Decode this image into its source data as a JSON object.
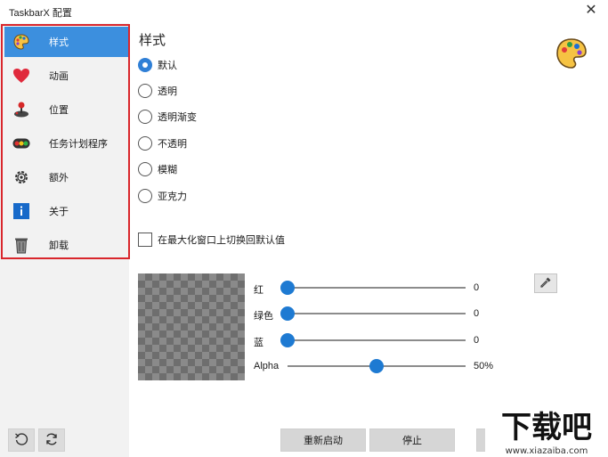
{
  "window": {
    "title": "TaskbarX 配置",
    "close_glyph": "✕"
  },
  "sidebar": {
    "items": [
      {
        "label": "样式",
        "icon": "palette-icon",
        "active": true
      },
      {
        "label": "动画",
        "icon": "heart-icon"
      },
      {
        "label": "位置",
        "icon": "joystick-icon"
      },
      {
        "label": "任务计划程序",
        "icon": "traffic-light-icon"
      },
      {
        "label": "额外",
        "icon": "gear-icon"
      },
      {
        "label": "关于",
        "icon": "info-icon"
      },
      {
        "label": "卸载",
        "icon": "trash-icon"
      }
    ],
    "bottom_buttons": [
      {
        "icon": "undo-icon"
      },
      {
        "icon": "refresh-icon"
      }
    ]
  },
  "main": {
    "heading": "样式",
    "styles": [
      {
        "label": "默认",
        "checked": true
      },
      {
        "label": "透明",
        "checked": false
      },
      {
        "label": "透明渐变",
        "checked": false
      },
      {
        "label": "不透明",
        "checked": false
      },
      {
        "label": "模糊",
        "checked": false
      },
      {
        "label": "亚克力",
        "checked": false
      }
    ],
    "revert_checkbox": {
      "label": "在最大化窗口上切换回默认值",
      "checked": false
    },
    "color": {
      "sliders": [
        {
          "label": "红",
          "value_text": "0",
          "fraction": 0
        },
        {
          "label": "绿色",
          "value_text": "0",
          "fraction": 0
        },
        {
          "label": "蓝",
          "value_text": "0",
          "fraction": 0
        },
        {
          "label": "Alpha",
          "value_text": "50%",
          "fraction": 0.5
        }
      ],
      "picker_icon": "eyedropper-icon"
    },
    "buttons": {
      "restart": "重新启动",
      "stop": "停止"
    }
  },
  "watermark": {
    "text": "下载吧",
    "url": "www.xiazaiba.com"
  },
  "colors": {
    "accent": "#3c8fde",
    "highlight_border": "#d9262c",
    "slider_thumb": "#1e7ad2"
  }
}
